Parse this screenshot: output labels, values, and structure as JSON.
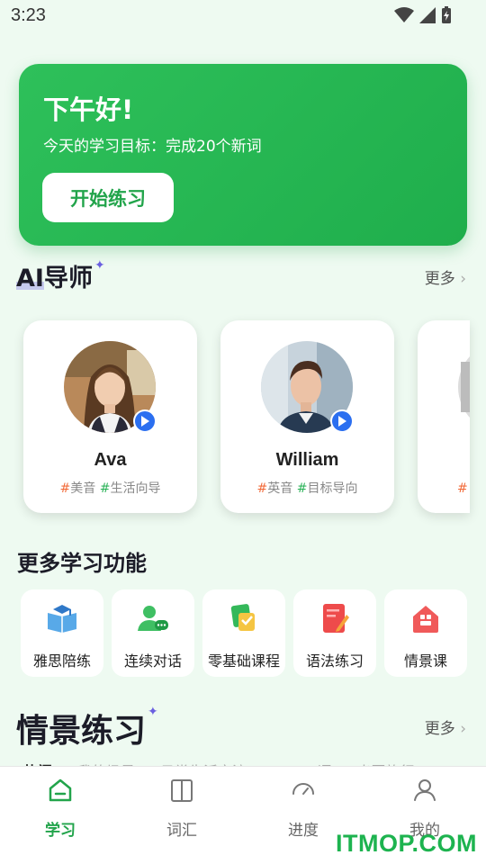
{
  "status_bar": {
    "time": "3:23"
  },
  "hero": {
    "greeting": "下午好!",
    "goal": "今天的学习目标：完成20个新词",
    "start_button": "开始练习"
  },
  "tutors_section": {
    "title_prefix": "AI",
    "title_suffix": "导师",
    "more": "更多",
    "tutors": [
      {
        "name": "Ava",
        "tag1": "美音",
        "tag2": "生活向导"
      },
      {
        "name": "William",
        "tag1": "英音",
        "tag2": "目标导向"
      }
    ]
  },
  "functions_section": {
    "title": "更多学习功能",
    "items": [
      {
        "label": "雅思陪练",
        "icon": "graduation-book-icon"
      },
      {
        "label": "连续对话",
        "icon": "chat-person-icon"
      },
      {
        "label": "零基础课程",
        "icon": "starter-course-icon"
      },
      {
        "label": "语法练习",
        "icon": "grammar-notebook-icon"
      },
      {
        "label": "情景课",
        "icon": "scene-house-icon"
      }
    ]
  },
  "scene_section": {
    "title": "情景练习",
    "more": "更多",
    "tabs": [
      "热门",
      "我的场景",
      "日常生活交流",
      "HOT口语",
      "出国旅行"
    ]
  },
  "bottom_nav": {
    "items": [
      {
        "label": "学习",
        "icon": "home-icon",
        "active": true
      },
      {
        "label": "词汇",
        "icon": "book-icon",
        "active": false
      },
      {
        "label": "进度",
        "icon": "gauge-icon",
        "active": false
      },
      {
        "label": "我的",
        "icon": "user-icon",
        "active": false
      }
    ]
  },
  "watermark": "ITMOP.COM",
  "colors": {
    "accent": "#22a44b",
    "background": "#eefaf1",
    "play": "#2b6ff0"
  }
}
